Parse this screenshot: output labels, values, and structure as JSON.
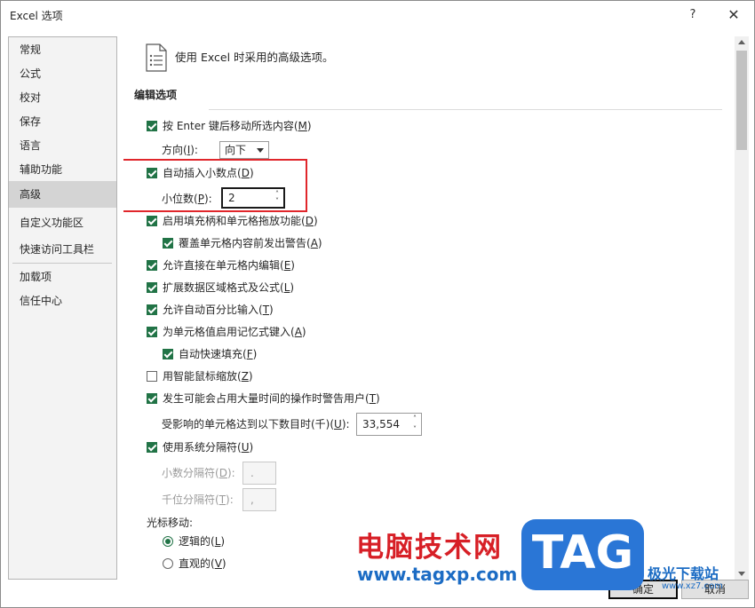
{
  "window": {
    "title": "Excel 选项",
    "help": "?",
    "close": "✕"
  },
  "nav": {
    "items": [
      {
        "label": "常规"
      },
      {
        "label": "公式"
      },
      {
        "label": "校对"
      },
      {
        "label": "保存"
      },
      {
        "label": "语言"
      },
      {
        "label": "辅助功能"
      },
      {
        "label": "高级",
        "selected": true
      },
      {
        "label": "自定义功能区"
      },
      {
        "label": "快速访问工具栏"
      },
      {
        "label": "加载项"
      },
      {
        "label": "信任中心"
      }
    ]
  },
  "content": {
    "header": "使用 Excel 时采用的高级选项。",
    "section": "编辑选项",
    "enter_move": {
      "label_a": "按 Enter 键后移动所选内容(",
      "key": "M",
      "label_b": ")",
      "checked": true
    },
    "direction": {
      "label_a": "方向(",
      "key": "I",
      "label_b": "):",
      "value": "向下"
    },
    "auto_decimal": {
      "label_a": "自动插入小数点(",
      "key": "D",
      "label_b": ")",
      "checked": true
    },
    "places": {
      "label_a": "小位数(",
      "key": "P",
      "label_b": "):",
      "value": "2"
    },
    "fill_handle": {
      "label_a": "启用填充柄和单元格拖放功能(",
      "key": "D",
      "label_b": ")",
      "checked": true
    },
    "overwrite_alert": {
      "label_a": "覆盖单元格内容前发出警告(",
      "key": "A",
      "label_b": ")",
      "checked": true
    },
    "edit_in_cell": {
      "label_a": "允许直接在单元格内编辑(",
      "key": "E",
      "label_b": ")",
      "checked": true
    },
    "extend_formats": {
      "label_a": "扩展数据区域格式及公式(",
      "key": "L",
      "label_b": ")",
      "checked": true
    },
    "auto_percent": {
      "label_a": "允许自动百分比输入(",
      "key": "T",
      "label_b": ")",
      "checked": true
    },
    "autocomplete": {
      "label_a": "为单元格值启用记忆式键入(",
      "key": "A",
      "label_b": ")",
      "checked": true
    },
    "flash_fill": {
      "label_a": "自动快速填充(",
      "key": "F",
      "label_b": ")",
      "checked": true
    },
    "intellimouse": {
      "label_a": "用智能鼠标缩放(",
      "key": "Z",
      "label_b": ")",
      "checked": false
    },
    "time_alert": {
      "label_a": "发生可能会占用大量时间的操作时警告用户(",
      "key": "T",
      "label_b": ")",
      "checked": true
    },
    "cells_threshold": {
      "label_a": "受影响的单元格达到以下数目时(千)(",
      "key": "U",
      "label_b": "):",
      "value": "33,554"
    },
    "system_sep": {
      "label_a": "使用系统分隔符(",
      "key": "U",
      "label_b": ")",
      "checked": true
    },
    "decimal_sep": {
      "label_a": "小数分隔符(",
      "key": "D",
      "label_b": "):",
      "value": "."
    },
    "thousands_sep": {
      "label_a": "千位分隔符(",
      "key": "T",
      "label_b": "):",
      "value": ","
    },
    "cursor_movement": "光标移动:",
    "logical": {
      "label_a": "逻辑的(",
      "key": "L",
      "label_b": ")",
      "selected": true
    },
    "visual": {
      "label_a": "直观的(",
      "key": "V",
      "label_b": ")",
      "selected": false
    }
  },
  "scrollbar": {
    "up": "▲",
    "down": "▼"
  },
  "buttons": {
    "ok": "确定",
    "cancel": "取消"
  },
  "watermark": {
    "text": "电脑技术网",
    "url": "www.tagxp.com",
    "tag": "TAG",
    "logo": "极光下载站",
    "logo_url": "www.xz7.com"
  },
  "colors": {
    "accent": "#217346",
    "highlight": "#e0262b"
  }
}
